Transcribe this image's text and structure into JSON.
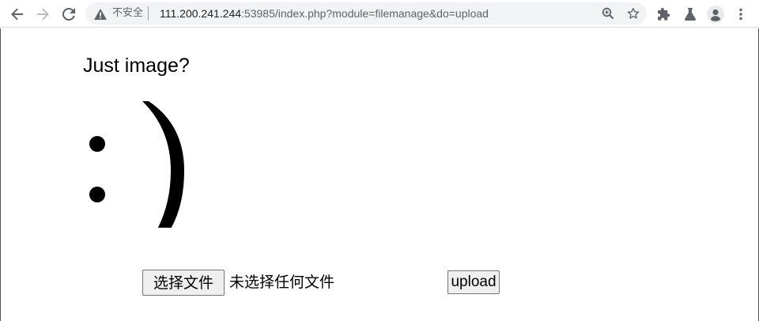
{
  "browser": {
    "security_label": "不安全",
    "url_host": "111.200.241.244",
    "url_rest": ":53985/index.php?module=filemanage&do=upload",
    "icons": [
      "back-icon",
      "forward-icon",
      "reload-icon",
      "warning-icon",
      "zoom-icon",
      "star-icon",
      "extensions-icon",
      "labs-icon",
      "profile-icon",
      "menu-icon"
    ]
  },
  "page": {
    "heading": "Just image?",
    "smiley": ": )",
    "file_button_label": "选择文件",
    "file_status": "未选择任何文件",
    "upload_button_label": "upload"
  },
  "colors": {
    "toolbar_bg": "#ffffff",
    "omnibox_bg": "#f1f3f4",
    "icon": "#5f6368",
    "button_bg": "#efefef"
  }
}
